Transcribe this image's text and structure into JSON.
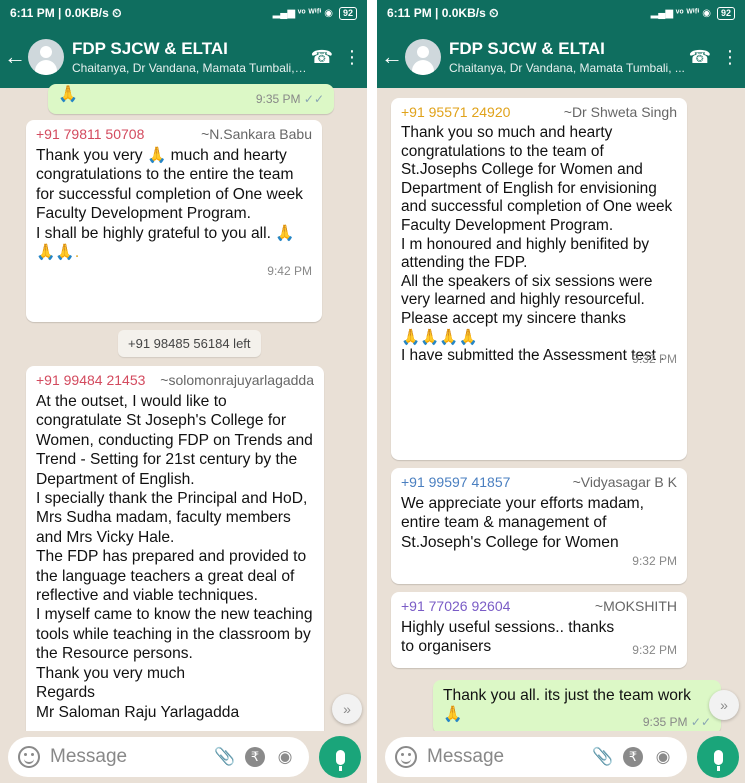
{
  "status": {
    "time_speed": "6:11 PM | 0.0KB/s ⏲",
    "network": "▂▄▆ ᵛᵒ ᵂⁱᶠⁱ ◉",
    "battery": "92"
  },
  "chat": {
    "title": "FDP SJCW & ELTAI",
    "members": "Chaitanya, Dr Vandana, Mamata Tumbali, ...",
    "add_call_icon": "☎",
    "menu_icon": "⋮"
  },
  "left": {
    "top_out": {
      "emoji": "🙏",
      "time": "9:35 PM",
      "ticks": "✓✓"
    },
    "msg1": {
      "phone": "+91 79811 50708",
      "name": "~N.Sankara Babu",
      "lines": [
        "Thank you very 🙏 much and hearty congratulations to the entire the team for successful completion of One week Faculty Development Program.",
        "I shall be highly grateful to you all. 🙏",
        "🙏🙏."
      ],
      "time": "9:42 PM"
    },
    "system": "+91 98485 56184 left",
    "msg2": {
      "phone": "+91 99484 21453",
      "name": "~solomonrajuyarlagadda",
      "lines": [
        "At the outset, I would like to congratulate St Joseph's College for Women,  conducting FDP on Trends and Trend - Setting for 21st century by the Department of English.",
        "I specially thank the Principal and HoD, Mrs Sudha madam, faculty members and Mrs Vicky Hale.",
        "The FDP has prepared and provided to the language teachers a great deal of reflective and viable techniques.",
        "I myself came to know the new teaching tools while teaching in the classroom by the Resource persons.",
        "Thank you very much",
        "Regards",
        "Mr Saloman Raju Yarlagadda"
      ]
    }
  },
  "right": {
    "msg1": {
      "phone": "+91 95571 24920",
      "name": "~Dr Shweta Singh",
      "lines": [
        "Thank you so much and hearty congratulations to the team of St.Josephs College for Women and Department of English for envisioning and successful completion of One week Faculty Development Program.",
        "I m honoured and highly benifited by attending the FDP.",
        "All the speakers of six sessions were very learned  and highly resourceful.",
        "Please accept my sincere thanks",
        "🙏🙏🙏🙏",
        "I have submitted the Assessment test ."
      ],
      "time": "9:32 PM"
    },
    "msg2": {
      "phone": "+91 99597 41857",
      "name": "~Vidyasagar B K",
      "lines": [
        "We appreciate your efforts madam, entire team & management of St.Joseph's College for Women"
      ],
      "time": "9:32 PM"
    },
    "msg3": {
      "phone": "+91 77026 92604",
      "name": "~MOKSHITH",
      "lines": [
        "Highly useful sessions.. thanks to organisers"
      ],
      "time": "9:32 PM"
    },
    "out": {
      "lines": [
        "Thank you all. its just the team work",
        "🙏"
      ],
      "time": "9:35 PM",
      "ticks": "✓✓"
    }
  },
  "composer": {
    "placeholder": "Message",
    "attach_icon": "📎",
    "rupee_icon": "₹",
    "camera_icon": "◉"
  },
  "scroll_icon": "»",
  "colors": {
    "header": "#0f6e5f",
    "chat_bg": "#e9e0d6",
    "out_bubble": "#dcf8c6",
    "mic": "#1aa57a",
    "sender_red": "#d34a5e",
    "sender_orange": "#e0a21a",
    "sender_blue": "#4a7fc0",
    "sender_purple": "#7a5cc6"
  }
}
